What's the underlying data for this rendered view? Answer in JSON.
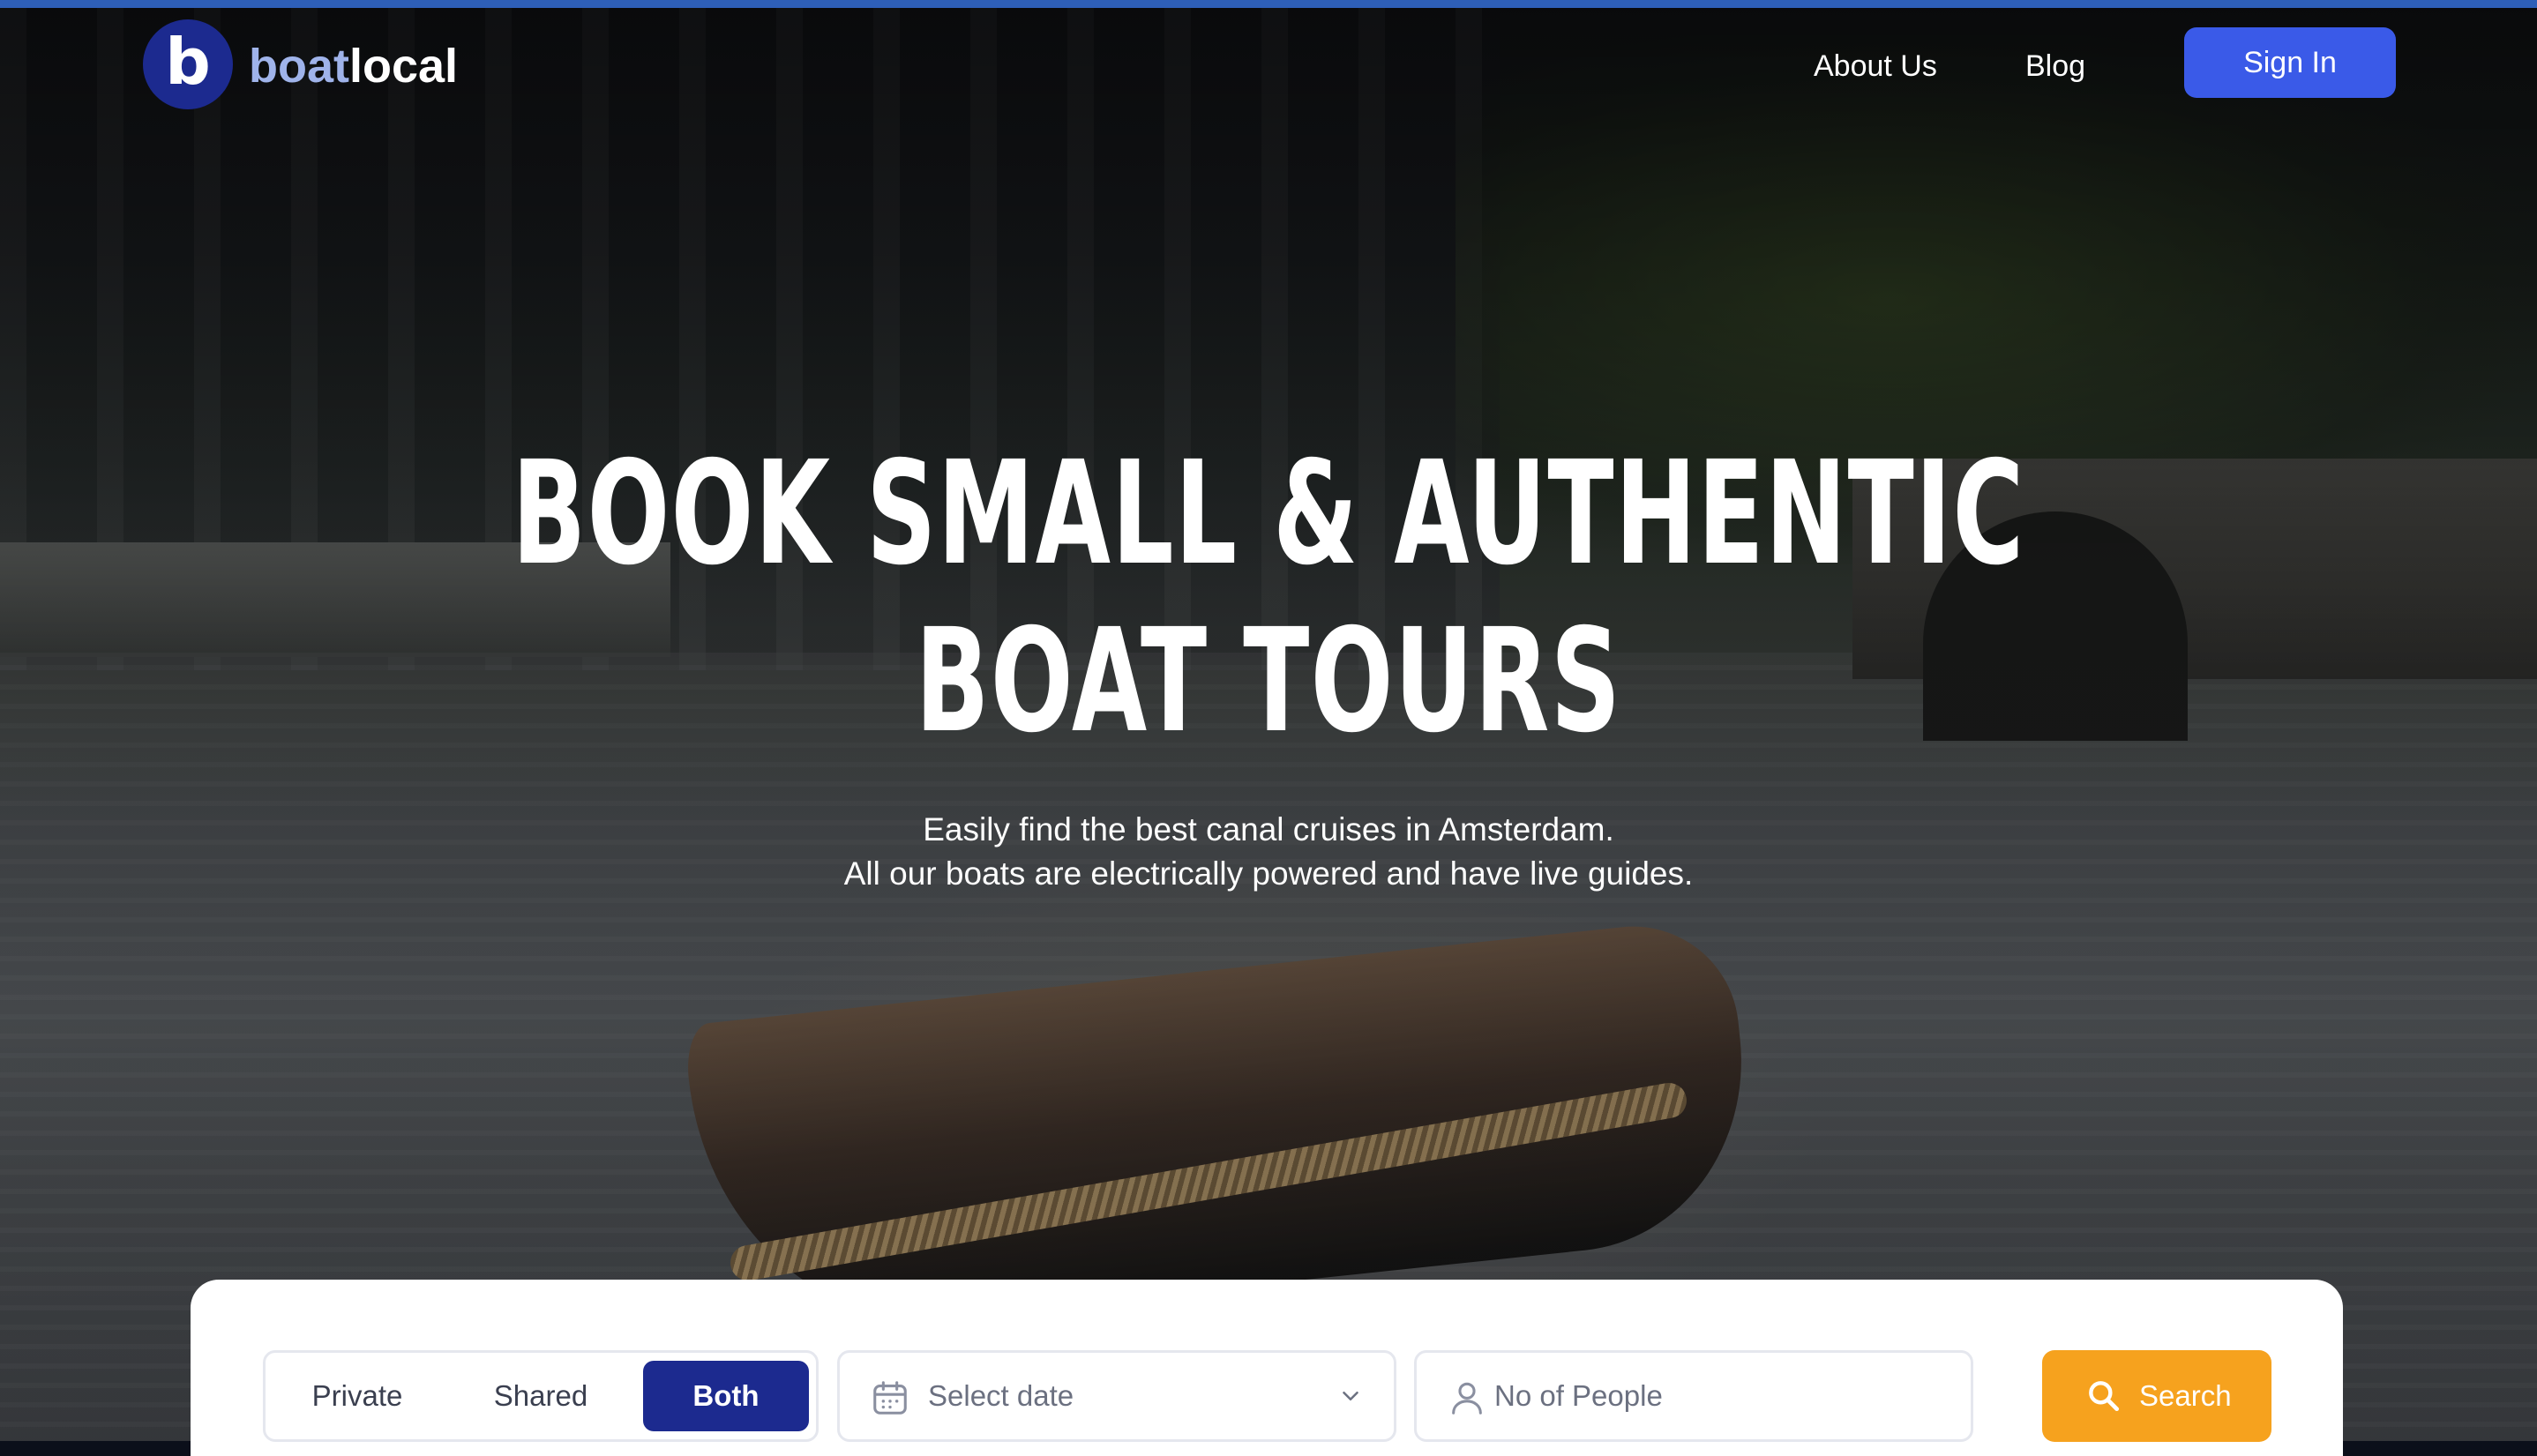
{
  "brand": {
    "logo_letter": "b",
    "name_part1": "boat",
    "name_part2": "local",
    "logo_color": "#1c2a8f"
  },
  "nav": {
    "about": "About Us",
    "blog": "Blog",
    "sign_in": "Sign In"
  },
  "hero": {
    "headline_line1": "BOOK SMALL & AUTHENTIC",
    "headline_line2": "BOAT TOURS",
    "subtitle_line1": "Easily find the best canal cruises in Amsterdam.",
    "subtitle_line2": "All our boats are electrically powered and have live guides."
  },
  "search": {
    "tour_types": [
      "Private",
      "Shared",
      "Both"
    ],
    "selected_type": "Both",
    "date_placeholder": "Select date",
    "people_placeholder": "No of People",
    "search_label": "Search"
  },
  "colors": {
    "accent_blue": "#3a5ae8",
    "selected_navy": "#1c2a8f",
    "search_orange": "#f6a21e"
  },
  "icons": [
    "calendar-icon",
    "chevron-down-icon",
    "user-icon",
    "search-icon"
  ]
}
